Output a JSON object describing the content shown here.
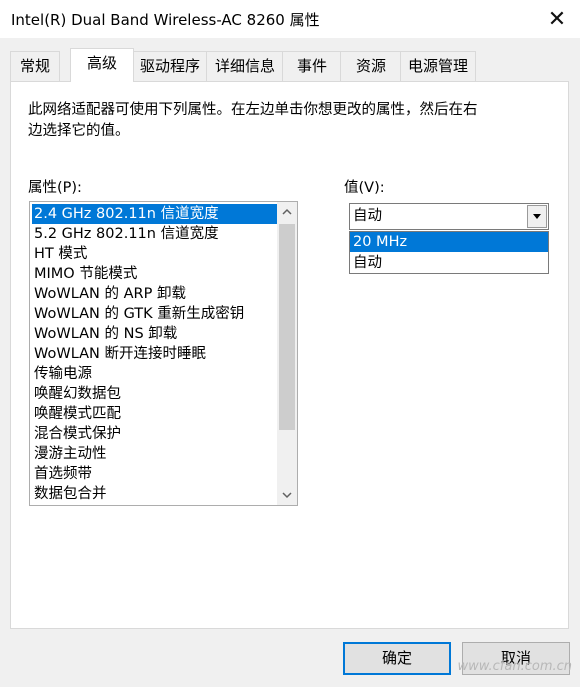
{
  "window": {
    "title": "Intel(R) Dual Band Wireless-AC 8260 属性",
    "close_symbol": "✕"
  },
  "tabs": [
    {
      "label": "常规",
      "active": false
    },
    {
      "label": "高级",
      "active": true
    },
    {
      "label": "驱动程序",
      "active": false
    },
    {
      "label": "详细信息",
      "active": false
    },
    {
      "label": "事件",
      "active": false
    },
    {
      "label": "资源",
      "active": false
    },
    {
      "label": "电源管理",
      "active": false
    }
  ],
  "advanced": {
    "description_line1": "此网络适配器可使用下列属性。在左边单击你想更改的属性，然后在右",
    "description_line2": "边选择它的值。",
    "property_label": "属性(P):",
    "value_label": "值(V):",
    "properties": [
      "2.4 GHz 802.11n 信道宽度",
      "5.2 GHz 802.11n 信道宽度",
      "HT 模式",
      "MIMO 节能模式",
      "WoWLAN 的 ARP 卸载",
      "WoWLAN 的 GTK 重新生成密钥",
      "WoWLAN 的 NS 卸载",
      "WoWLAN 断开连接时睡眠",
      "传输电源",
      "唤醒幻数据包",
      "唤醒模式匹配",
      "混合模式保护",
      "漫游主动性",
      "首选频带",
      "数据包合并"
    ],
    "selected_property_index": 0,
    "value_selected": "自动",
    "value_options": [
      "20 MHz",
      "自动"
    ],
    "highlighted_option_index": 0
  },
  "buttons": {
    "ok": "确定",
    "cancel": "取消"
  },
  "watermark": "www.cfan.com.cn",
  "icons": {
    "scroll_up": "chevron-up-icon",
    "scroll_down": "chevron-down-icon",
    "combo_arrow": "triangle-down-icon"
  },
  "colors": {
    "selection": "#0078d7",
    "panel_bg": "#ffffff",
    "window_bg": "#f0f0f0"
  }
}
